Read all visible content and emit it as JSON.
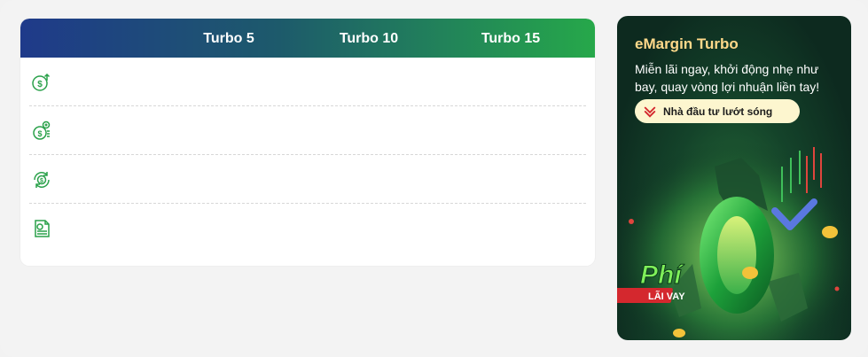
{
  "table": {
    "columns": [
      "Turbo 5",
      "Turbo 10",
      "Turbo 15"
    ],
    "rows": [
      {
        "icon": "money-up-icon"
      },
      {
        "icon": "coins-plus-icon"
      },
      {
        "icon": "money-cycle-icon"
      },
      {
        "icon": "document-money-icon"
      }
    ]
  },
  "promo": {
    "title": "eMargin Turbo",
    "description": "Miễn lãi ngay, khởi động nhẹ như bay, quay vòng lợi nhuận liền tay!",
    "pill_label": "Nhà đầu tư lướt sóng",
    "art": {
      "word": "Phí",
      "ribbon": "LÃI VAY",
      "number": "0"
    }
  },
  "colors": {
    "accent_green": "#26a84a",
    "header_blue": "#1f3a8a",
    "promo_title": "#ffd98a",
    "pill_bg": "#fdf6cf"
  }
}
